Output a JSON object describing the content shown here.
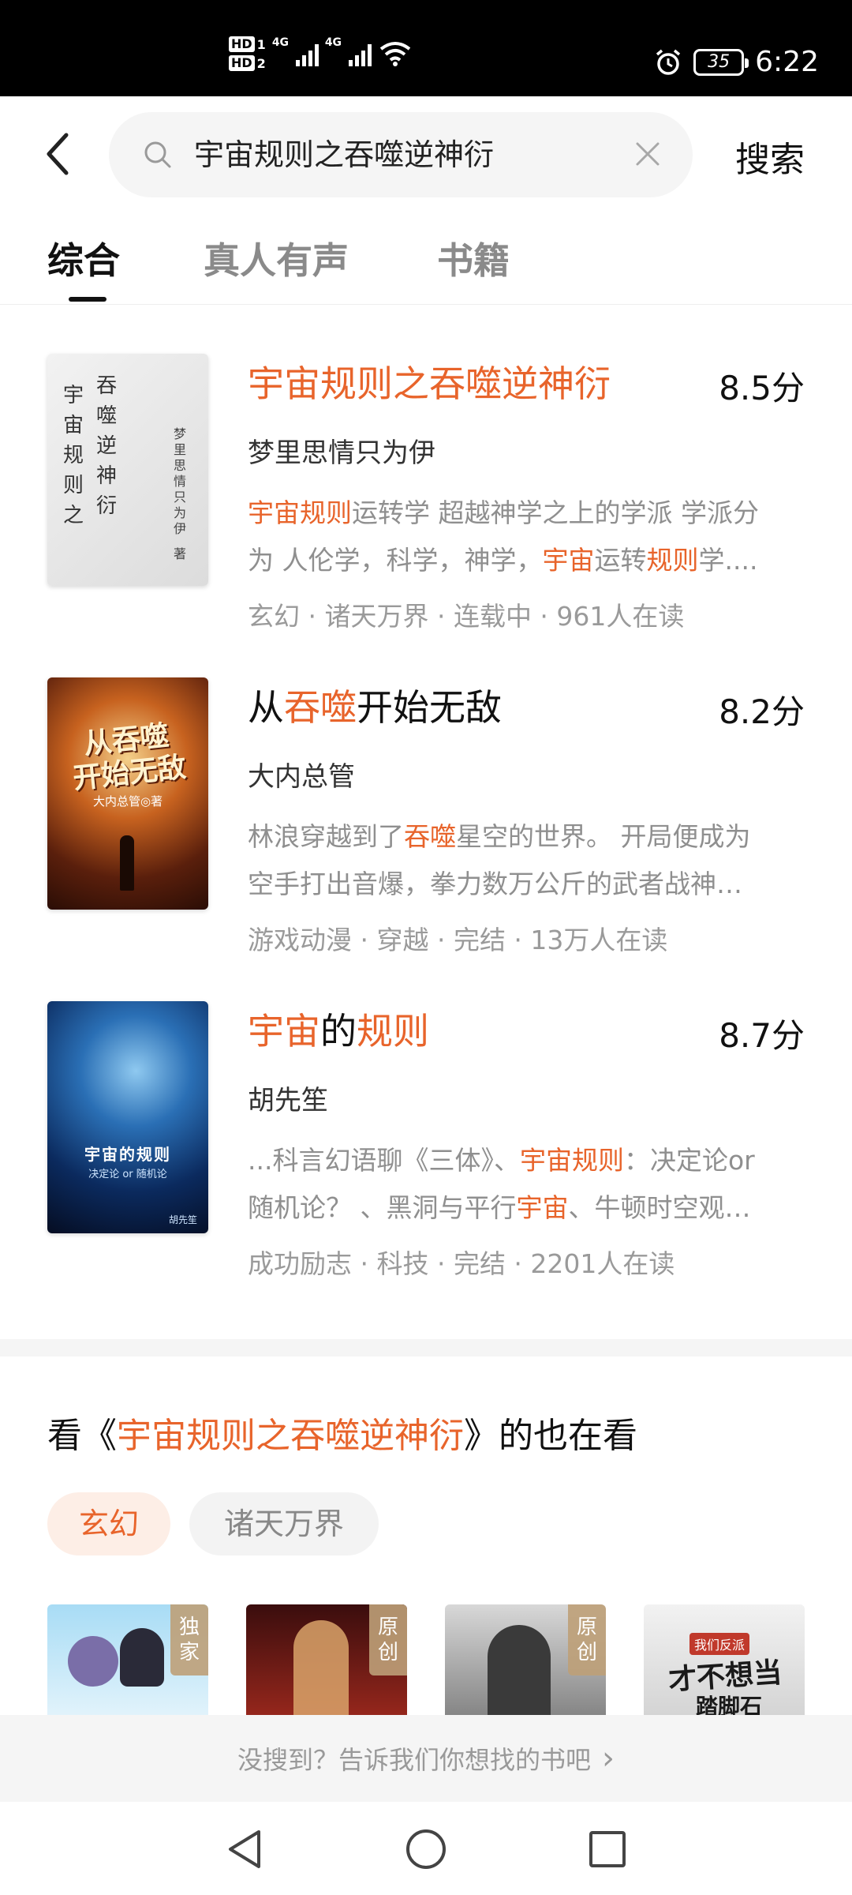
{
  "status_bar": {
    "hd1": "HD",
    "hd1_num": "1",
    "hd2": "HD",
    "hd2_num": "2",
    "net1": "4G",
    "net2": "4G",
    "battery": "35",
    "time": "6:22"
  },
  "search": {
    "query": "宇宙规则之吞噬逆神衍",
    "button_label": "搜索"
  },
  "tabs": [
    {
      "label": "综合",
      "active": true
    },
    {
      "label": "真人有声",
      "active": false
    },
    {
      "label": "书籍",
      "active": false
    }
  ],
  "results": [
    {
      "title_parts": [
        {
          "text": "宇宙规则之吞噬逆神衍",
          "hl": true
        }
      ],
      "score": "8.5分",
      "author": "梦里思情只为伊",
      "desc_lines": [
        [
          {
            "text": "宇宙规则",
            "hl": true
          },
          {
            "text": "运转学 超越神学之上的学派 学派分",
            "hl": false
          }
        ],
        [
          {
            "text": "为 人伦学，科学，神学，",
            "hl": false
          },
          {
            "text": "宇宙",
            "hl": true
          },
          {
            "text": "运转",
            "hl": false
          },
          {
            "text": "规则",
            "hl": true
          },
          {
            "text": "学....",
            "hl": false
          }
        ]
      ],
      "meta": "玄幻 · 诸天万界 · 连载中 · 961人在读",
      "cover": {
        "title_cols": [
          "吞噬逆神衍",
          "宇宙规则之"
        ],
        "author_col": "梦里思情只为伊",
        "author_suffix": "著"
      }
    },
    {
      "title_parts": [
        {
          "text": "从",
          "hl": false
        },
        {
          "text": "吞噬",
          "hl": true
        },
        {
          "text": "开始无敌",
          "hl": false
        }
      ],
      "score": "8.2分",
      "author": "大内总管",
      "desc_lines": [
        [
          {
            "text": "林浪穿越到了",
            "hl": false
          },
          {
            "text": "吞噬",
            "hl": true
          },
          {
            "text": "星空的世界。 开局便成为",
            "hl": false
          }
        ],
        [
          {
            "text": "空手打出音爆，拳力数万公斤的武者战神…",
            "hl": false
          }
        ]
      ],
      "meta": "游戏动漫 · 穿越 · 完结 · 13万人在读",
      "cover": {
        "line1": "从吞噬",
        "line2": "开始无敌",
        "byline": "大内总管◎著"
      }
    },
    {
      "title_parts": [
        {
          "text": "宇宙",
          "hl": true
        },
        {
          "text": "的",
          "hl": false
        },
        {
          "text": "规则",
          "hl": true
        }
      ],
      "score": "8.7分",
      "author": "胡先笙",
      "desc_lines": [
        [
          {
            "text": "...科言幻语聊《三体》、",
            "hl": false
          },
          {
            "text": "宇宙规则",
            "hl": true
          },
          {
            "text": "：决定论or",
            "hl": false
          }
        ],
        [
          {
            "text": "随机论？ 、黑洞与平行",
            "hl": false
          },
          {
            "text": "宇宙",
            "hl": true
          },
          {
            "text": "、牛顿时空观…",
            "hl": false
          }
        ]
      ],
      "meta": "成功励志 · 科技 · 完结 · 2201人在读",
      "cover": {
        "title": "宇宙的规则",
        "subtitle": "决定论 or 随机论",
        "author": "胡先笙"
      }
    }
  ],
  "also_reading": {
    "prefix": "看《",
    "book": "宇宙规则之吞噬逆神衍",
    "suffix": "》的也在看",
    "chips": [
      {
        "label": "玄幻",
        "active": true
      },
      {
        "label": "诸天万界",
        "active": false
      }
    ],
    "recs": [
      {
        "badge": [
          "独",
          "家"
        ]
      },
      {
        "badge": [
          "原",
          "创"
        ]
      },
      {
        "badge": [
          "原",
          "创"
        ]
      },
      {
        "badge": null,
        "cover_text": [
          "我们反派",
          "才不想当",
          "踏脚石"
        ]
      }
    ]
  },
  "feedback": {
    "text": "没搜到？告诉我们你想找的书吧",
    "arrow": "›"
  },
  "colors": {
    "accent": "#e8642b",
    "muted": "#8f8f8f"
  }
}
